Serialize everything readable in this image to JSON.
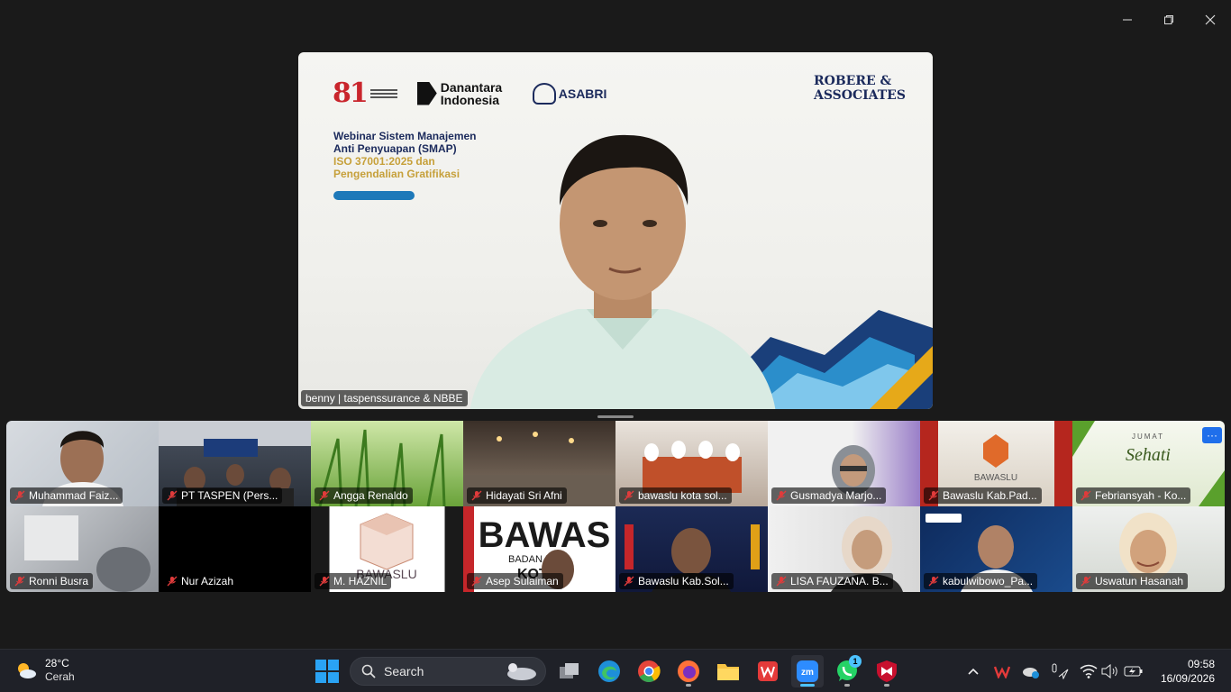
{
  "window": {
    "controls": [
      "minimize",
      "restore",
      "close"
    ]
  },
  "speaker": {
    "name": "benny | taspenssurance & NBBE",
    "slide": {
      "logo_81": "81",
      "logo_danantara": "Danantara Indonesia",
      "logo_asabri": "ASABRI",
      "logo_robere": "ROBERE & ASSOCIATES",
      "title_line1": "Webinar Sistem Manajemen",
      "title_line2": "Anti Penyuapan (SMAP)",
      "title_line3": "ISO 37001:2025 dan",
      "title_line4": "Pengendalian Gratifikasi"
    }
  },
  "participants": [
    {
      "name": "Muhammad Faiz...",
      "muted": true
    },
    {
      "name": "PT TASPEN (Pers...",
      "muted": true
    },
    {
      "name": "Angga Renaldo",
      "muted": true
    },
    {
      "name": "Hidayati Sri Afni",
      "muted": true
    },
    {
      "name": "bawaslu kota sol...",
      "muted": true
    },
    {
      "name": "Gusmadya Marjo...",
      "muted": true
    },
    {
      "name": "Bawaslu Kab.Pad...",
      "muted": true
    },
    {
      "name": "Febriansyah - Ko...",
      "muted": true
    },
    {
      "name": "Ronni Busra",
      "muted": true
    },
    {
      "name": "Nur Azizah",
      "muted": true
    },
    {
      "name": "M. HAZNIL",
      "muted": true
    },
    {
      "name": "Asep Sulaiman",
      "muted": true
    },
    {
      "name": "Bawaslu Kab.Sol...",
      "muted": true
    },
    {
      "name": "LISA FAUZANA. B...",
      "muted": true
    },
    {
      "name": "kabulwibowo_Pa...",
      "muted": true
    },
    {
      "name": "Uswatun Hasanah",
      "muted": true
    }
  ],
  "tile_text": {
    "bawaslu": "BAWASLU",
    "bawas_big": "BAWAS",
    "badan": "BADAN PEN",
    "kota": "KOTA",
    "sehati_top": "JUMAT",
    "sehati": "Sehati",
    "more": "···"
  },
  "taskbar": {
    "weather_temp": "28°C",
    "weather_cond": "Cerah",
    "search_label": "Search",
    "whatsapp_badge": "1",
    "time": "09:58",
    "date": "16/09/2026"
  }
}
